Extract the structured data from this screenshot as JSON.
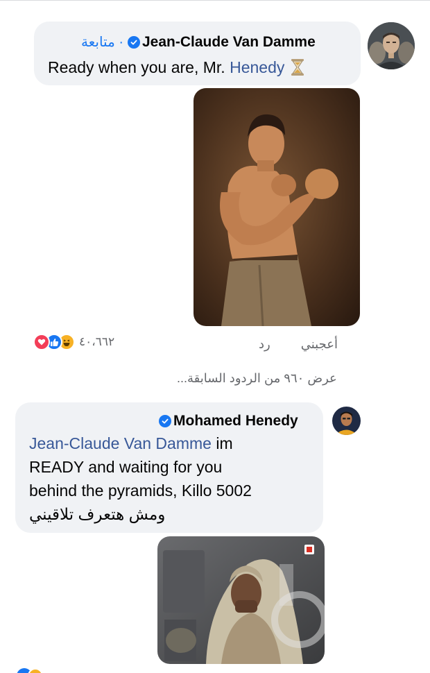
{
  "comment1": {
    "author": "Jean-Claude Van Damme",
    "follow_label": "· متابعة",
    "text_prefix": "Ready when you are, Mr. ",
    "mention": "Henedy",
    "emoji_icon": "hourglass-icon",
    "like_label": "أعجبني",
    "reply_label": "رد",
    "reaction_count": "٤٠،٦٦٢",
    "reaction_icons": [
      "love-icon",
      "like-icon",
      "haha-icon"
    ]
  },
  "view_previous": "عرض ٩٦٠ من الردود السابقة...",
  "comment2": {
    "author": "Mohamed Henedy",
    "mention": "Jean-Claude Van Damme",
    "line1_rest": " im",
    "line2": "READY and waiting for you",
    "line3": "behind the pyramids, Killo 5002",
    "line4": "ومش هتعرف تلاقيني"
  },
  "colors": {
    "accent": "#1877f2",
    "mention": "#385898",
    "bubble": "#f0f2f5",
    "secondary_text": "#65676b",
    "love": "#f33e58",
    "haha": "#f7b125"
  }
}
